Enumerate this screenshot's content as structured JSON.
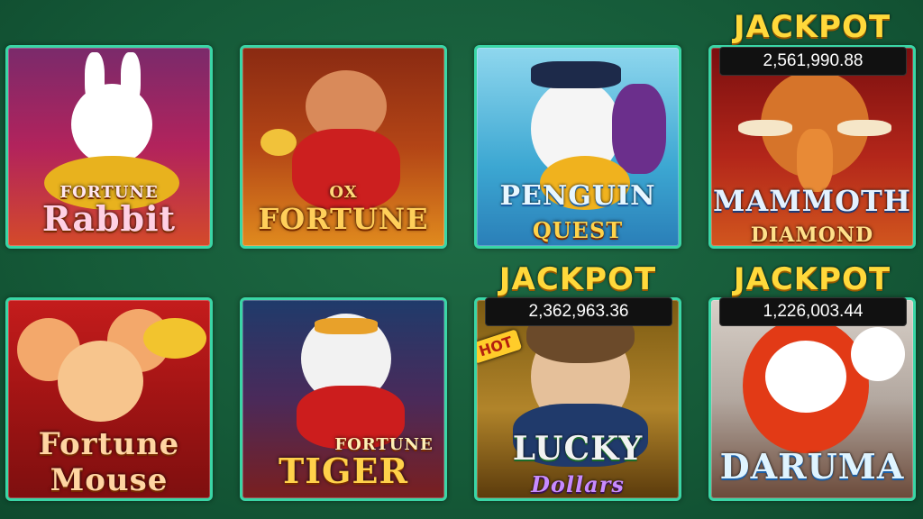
{
  "games": [
    {
      "title_top": "FORTUNE",
      "title_main": "Rabbit"
    },
    {
      "title_top": "OX",
      "title_main": "FORTUNE"
    },
    {
      "title_top": "PENGUIN",
      "title_main": "QUEST"
    },
    {
      "title_top": "MAMMOTH",
      "title_main": "DIAMOND"
    },
    {
      "title_top": "Fortune",
      "title_main": "Mouse"
    },
    {
      "title_top": "FORTUNE",
      "title_main": "TIGER"
    },
    {
      "title_top": "LUCKY",
      "title_main": "Dollars",
      "badge": "HOT"
    },
    {
      "title_top": "DARUMA",
      "title_main": ""
    }
  ],
  "jackpots": [
    {
      "label": "JACKPOT",
      "value": "2,561,990.88"
    },
    {
      "label": "JACKPOT",
      "value": "2,362,963.36"
    },
    {
      "label": "JACKPOT",
      "value": "1,226,003.44"
    }
  ],
  "colors": {
    "background": "#155a38",
    "tile_border": "#3ad6a6",
    "jackpot_text": "#ffd93b"
  }
}
